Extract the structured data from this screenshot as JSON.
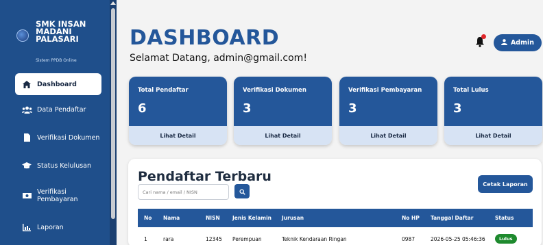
{
  "sidebar": {
    "brand": {
      "line1": "SMK INSAN",
      "line2": "MADANI",
      "line3": "PALASARI",
      "subtitle": "Sistem PPDB Online"
    },
    "items": [
      {
        "label": "Dashboard",
        "icon": "home-icon",
        "active": true
      },
      {
        "label": "Data Pendaftar",
        "icon": "users-icon"
      },
      {
        "label": "Verifikasi Dokumen",
        "icon": "file-icon"
      },
      {
        "label": "Status Kelulusan",
        "icon": "graduation-cap-icon"
      },
      {
        "label_line1": "Verifikasi",
        "label_line2": "Pembayaran",
        "icon": "money-icon"
      },
      {
        "label": "Laporan",
        "icon": "chart-icon"
      }
    ]
  },
  "header": {
    "title": "DASHBOARD",
    "welcome": "Selamat Datang, admin@gmail.com!",
    "user_label": "Admin"
  },
  "cards": [
    {
      "title": "Total Pendaftar",
      "value": "6",
      "link": "Lihat Detail"
    },
    {
      "title": "Verifikasi Dokumen",
      "value": "3",
      "link": "Lihat Detail"
    },
    {
      "title": "Verifikasi Pembayaran",
      "value": "3",
      "link": "Lihat Detail"
    },
    {
      "title": "Total Lulus",
      "value": "3",
      "link": "Lihat Detail"
    }
  ],
  "table": {
    "title": "Pendaftar Terbaru",
    "search_placeholder": "Cari nama / email / NISN",
    "print_label": "Cetak Laporan",
    "columns": [
      "No",
      "Nama",
      "NISN",
      "Jenis Kelamin",
      "Jurusan",
      "No HP",
      "Tanggal Daftar",
      "Status"
    ],
    "rows": [
      [
        "1",
        "rara",
        "12345",
        "Perempuan",
        "Teknik Kendaraan Ringan",
        "0987",
        "2026-05-25 05:46:36",
        "Lulus"
      ]
    ]
  },
  "colors": {
    "primary": "#24579a",
    "sidebar": "#1f4f8b",
    "success": "#1e8a2e",
    "alert": "#e0262a"
  }
}
